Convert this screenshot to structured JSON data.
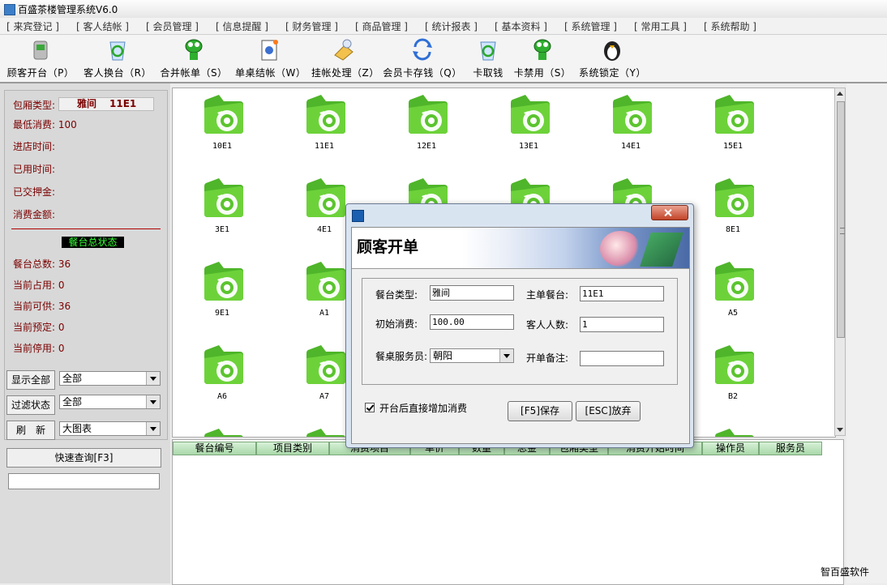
{
  "window": {
    "title": "百盛茶楼管理系统V6.0"
  },
  "menu": [
    "[ 来宾登记 ]",
    "[ 客人结帐 ]",
    "[ 会员管理 ]",
    "[ 信息提醒 ]",
    "[ 财务管理 ]",
    "[ 商品管理 ]",
    "[ 统计报表 ]",
    "[ 基本资料 ]",
    "[ 系统管理 ]",
    "[ 常用工具 ]",
    "[ 系统帮助 ]"
  ],
  "toolbar": [
    {
      "label": "顾客开台（P）",
      "icon": "trash-bin-icon"
    },
    {
      "label": "客人换台（R）",
      "icon": "recycle-bin-icon"
    },
    {
      "label": "合并帐单（S）",
      "icon": "character-icon"
    },
    {
      "label": "单桌结帐（W）",
      "icon": "document-icon"
    },
    {
      "label": "挂帐处理（Z）",
      "icon": "pencil-icon"
    },
    {
      "label": "会员卡存钱（Q）",
      "icon": "sync-icon"
    },
    {
      "label": "卡取钱",
      "icon": "recycle-bin-icon"
    },
    {
      "label": "卡禁用（S）",
      "icon": "character-icon"
    },
    {
      "label": "系统锁定（Y）",
      "icon": "penguin-icon"
    }
  ],
  "info": {
    "room_type_label": "包厢类型:",
    "room_type_value": "雅间",
    "room_code": "11E1",
    "min_consume": "最低消费: 100",
    "checkin_time": "进店时间:",
    "used_time": "已用时间:",
    "deposit": "已交押金:",
    "consume_amount": "消费金额:",
    "status_header": "餐台总状态",
    "total": "餐台总数: 36",
    "occupied": "当前占用: 0",
    "available": "当前可供: 36",
    "reserved": "当前预定: 0",
    "disabled": "当前停用: 0"
  },
  "filters": {
    "show_all_label": "显示全部",
    "show_all_value": "全部",
    "filter_status_label": "过滤状态",
    "filter_status_value": "全部",
    "refresh_label": "刷　新",
    "view_value": "大图表",
    "quick_query_label": "快速查询[F3]"
  },
  "tables": [
    "10E1",
    "11E1",
    "12E1",
    "13E1",
    "14E1",
    "15E1",
    "3E1",
    "4E1",
    "",
    "",
    "",
    "8E1",
    "9E1",
    "A1",
    "",
    "",
    "",
    "A5",
    "A6",
    "A7",
    "",
    "",
    "",
    "B2"
  ],
  "bottom_columns": [
    "餐台编号",
    "项目类别",
    "消费项目",
    "单价",
    "数量",
    "总金",
    "包厢类型",
    "消费开始时间",
    "操作员",
    "服务员"
  ],
  "brand": "智百盛软件",
  "dialog": {
    "title": "顾客开单",
    "table_type_label": "餐台类型:",
    "table_type_value": "雅间",
    "main_table_label": "主单餐台:",
    "main_table_value": "11E1",
    "initial_consume_label": "初始消费:",
    "initial_consume_value": "100.00",
    "guest_count_label": "客人人数:",
    "guest_count_value": "1",
    "waiter_label": "餐桌服务员:",
    "waiter_value": "朝阳",
    "note_label": "开单备注:",
    "note_value": "",
    "checkbox_label": "开台后直接增加消费",
    "save_label": "[F5]保存",
    "cancel_label": "[ESC]放弃"
  },
  "colors": {
    "accent_red": "#7a0000",
    "status_green": "#33ff33",
    "tile_green": "#5bc42e"
  }
}
